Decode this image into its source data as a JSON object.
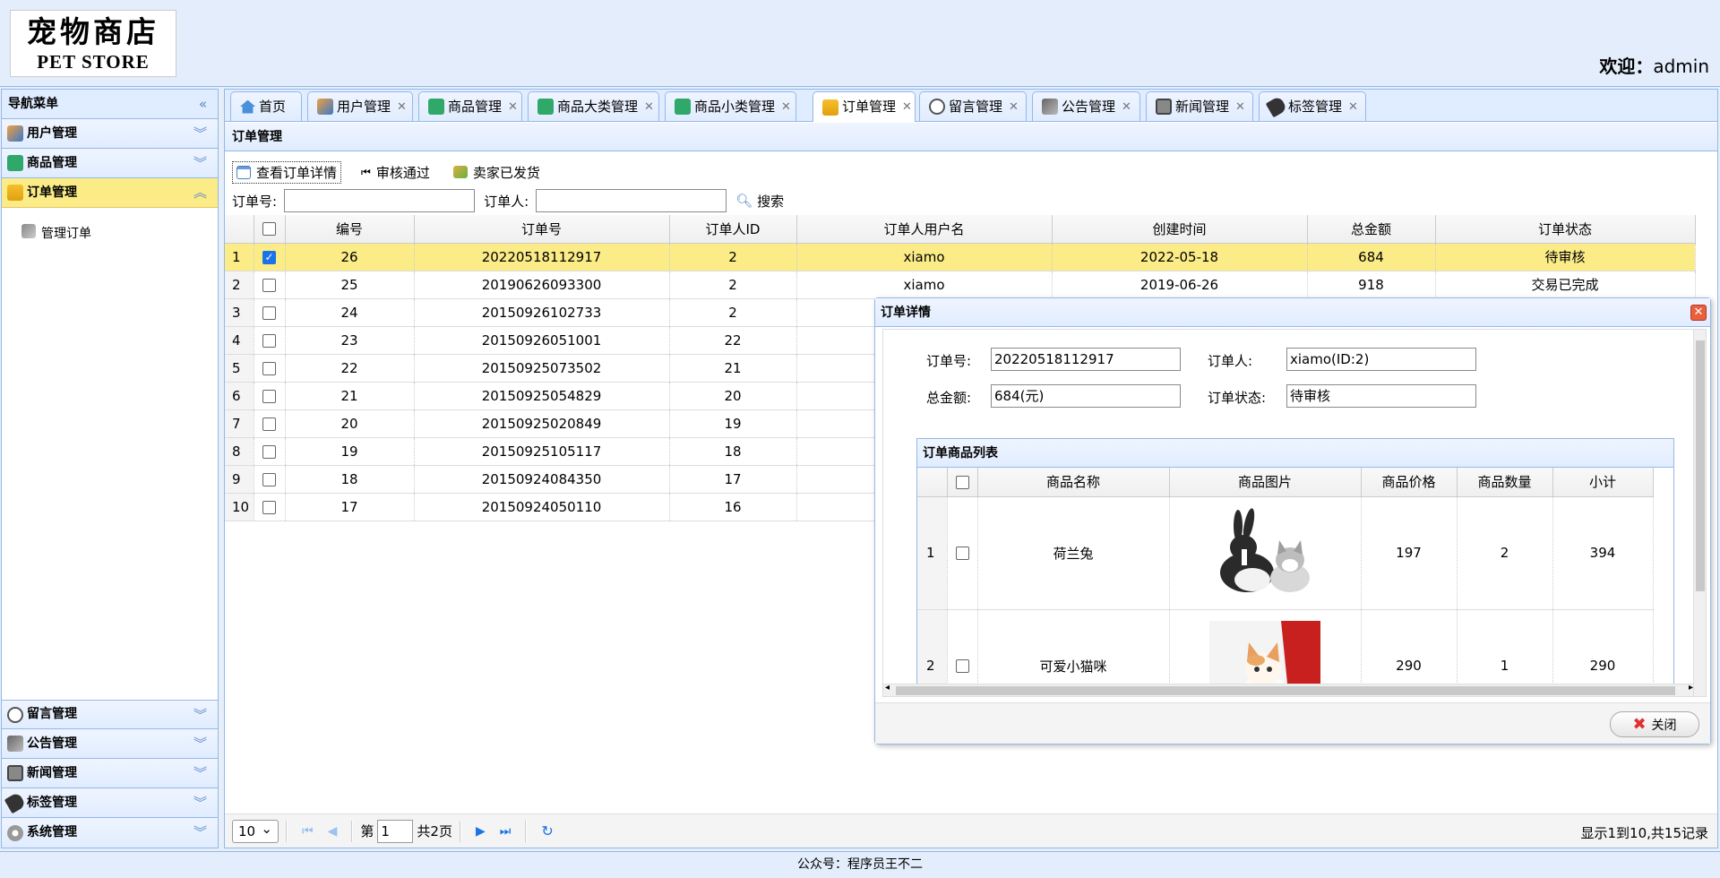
{
  "header": {
    "logo_cn": "宠物商店",
    "logo_en": "PET STORE",
    "welcome_label": "欢迎：",
    "welcome_user": "admin"
  },
  "sidebar": {
    "title": "导航菜单",
    "items_top": [
      {
        "label": "用户管理",
        "icon": "users-icon"
      },
      {
        "label": "商品管理",
        "icon": "grid-icon"
      },
      {
        "label": "订单管理",
        "icon": "chart-icon"
      }
    ],
    "sub_items": [
      {
        "label": "管理订单",
        "icon": "tools-icon"
      }
    ],
    "items_bottom": [
      {
        "label": "留言管理",
        "icon": "comment-icon"
      },
      {
        "label": "公告管理",
        "icon": "notice-icon"
      },
      {
        "label": "新闻管理",
        "icon": "news-icon"
      },
      {
        "label": "标签管理",
        "icon": "tag-icon"
      },
      {
        "label": "系统管理",
        "icon": "gear-icon"
      }
    ]
  },
  "tabs": [
    {
      "label": "首页",
      "closable": false
    },
    {
      "label": "用户管理",
      "closable": true
    },
    {
      "label": "商品管理",
      "closable": true
    },
    {
      "label": "商品大类管理",
      "closable": true
    },
    {
      "label": "商品小类管理",
      "closable": true
    },
    {
      "label": "订单管理",
      "closable": true,
      "selected": true
    },
    {
      "label": "留言管理",
      "closable": true
    },
    {
      "label": "公告管理",
      "closable": true
    },
    {
      "label": "新闻管理",
      "closable": true
    },
    {
      "label": "标签管理",
      "closable": true
    }
  ],
  "panel": {
    "title": "订单管理"
  },
  "toolbar": {
    "view_detail": "查看订单详情",
    "approve": "审核通过",
    "shipped": "卖家已发货"
  },
  "search": {
    "order_no_label": "订单号:",
    "orderer_label": "订单人:",
    "search_button": "搜索"
  },
  "grid": {
    "columns": [
      "编号",
      "订单号",
      "订单人ID",
      "订单人用户名",
      "创建时间",
      "总金额",
      "订单状态"
    ],
    "rows": [
      {
        "n": "1",
        "checked": true,
        "id": "26",
        "order_no": "20220518112917",
        "uid": "2",
        "uname": "xiamo",
        "created": "2022-05-18",
        "total": "684",
        "status": "待审核"
      },
      {
        "n": "2",
        "checked": false,
        "id": "25",
        "order_no": "20190626093300",
        "uid": "2",
        "uname": "xiamo",
        "created": "2019-06-26",
        "total": "918",
        "status": "交易已完成"
      },
      {
        "n": "3",
        "checked": false,
        "id": "24",
        "order_no": "20150926102733",
        "uid": "2",
        "uname": "",
        "created": "",
        "total": "",
        "status": ""
      },
      {
        "n": "4",
        "checked": false,
        "id": "23",
        "order_no": "20150926051001",
        "uid": "22",
        "uname": "",
        "created": "",
        "total": "",
        "status": ""
      },
      {
        "n": "5",
        "checked": false,
        "id": "22",
        "order_no": "20150925073502",
        "uid": "21",
        "uname": "",
        "created": "",
        "total": "",
        "status": ""
      },
      {
        "n": "6",
        "checked": false,
        "id": "21",
        "order_no": "20150925054829",
        "uid": "20",
        "uname": "",
        "created": "",
        "total": "",
        "status": ""
      },
      {
        "n": "7",
        "checked": false,
        "id": "20",
        "order_no": "20150925020849",
        "uid": "19",
        "uname": "",
        "created": "",
        "total": "",
        "status": ""
      },
      {
        "n": "8",
        "checked": false,
        "id": "19",
        "order_no": "20150925105117",
        "uid": "18",
        "uname": "",
        "created": "",
        "total": "",
        "status": ""
      },
      {
        "n": "9",
        "checked": false,
        "id": "18",
        "order_no": "20150924084350",
        "uid": "17",
        "uname": "",
        "created": "",
        "total": "",
        "status": ""
      },
      {
        "n": "10",
        "checked": false,
        "id": "17",
        "order_no": "20150924050110",
        "uid": "16",
        "uname": "",
        "created": "",
        "total": "",
        "status": ""
      }
    ]
  },
  "pager": {
    "page_size": "10",
    "page_prefix": "第",
    "page_value": "1",
    "page_total": "共2页",
    "info": "显示1到10,共15记录"
  },
  "footer": {
    "text": "公众号：程序员王不二"
  },
  "dialog": {
    "title": "订单详情",
    "order_no_label": "订单号:",
    "order_no": "20220518112917",
    "orderer_label": "订单人:",
    "orderer": "xiamo(ID:2)",
    "total_label": "总金额:",
    "total": "684(元)",
    "status_label": "订单状态:",
    "status": "待审核",
    "items_title": "订单商品列表",
    "item_columns": [
      "商品名称",
      "商品图片",
      "商品价格",
      "商品数量",
      "小计"
    ],
    "items": [
      {
        "n": "1",
        "name": "荷兰兔",
        "price": "197",
        "qty": "2",
        "subtotal": "394"
      },
      {
        "n": "2",
        "name": "可爱小猫咪",
        "price": "290",
        "qty": "1",
        "subtotal": "290"
      }
    ],
    "close_button": "关闭"
  }
}
